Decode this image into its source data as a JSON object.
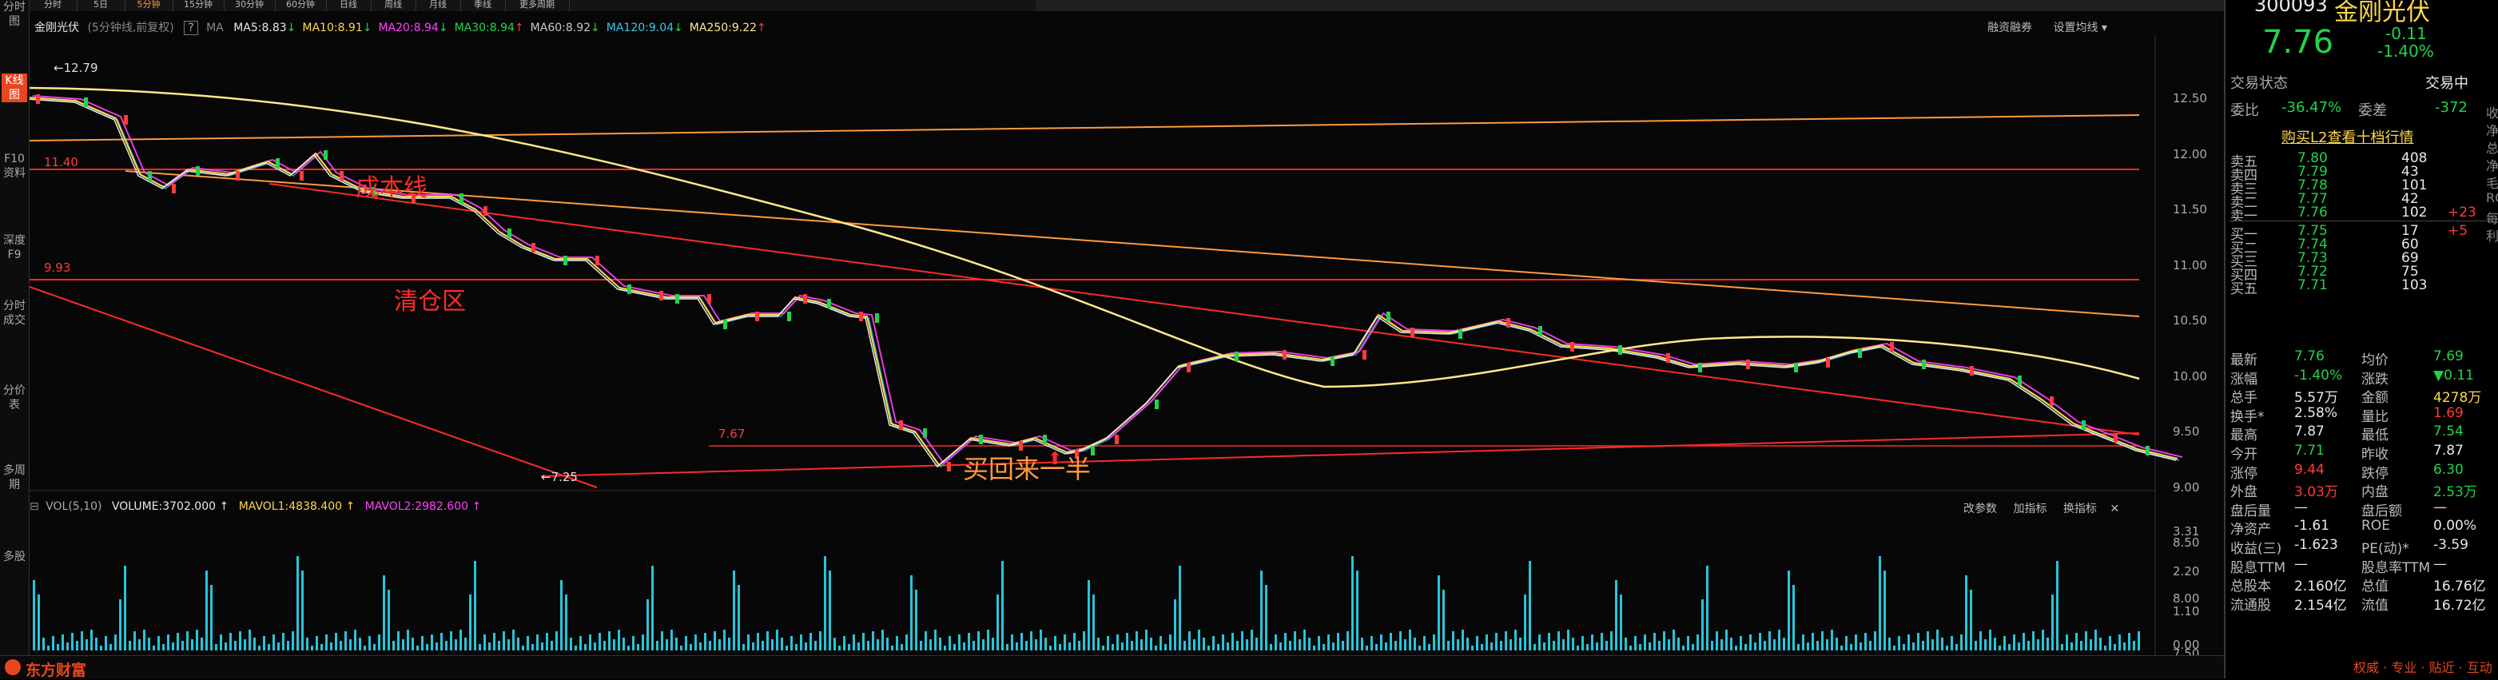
{
  "top_tabs": [
    "分时",
    "5日",
    "5分钟",
    "15分钟",
    "30分钟",
    "60分钟",
    "日线",
    "周线",
    "月线",
    "季线",
    "更多周期"
  ],
  "top_tab_active": 2,
  "left_tabs": [
    {
      "label": "分时图"
    },
    {
      "label": "K线图",
      "active": true
    },
    {
      "label": "F10资料"
    },
    {
      "label": "深度F9"
    },
    {
      "label": "分时成交"
    },
    {
      "label": "分价表"
    },
    {
      "label": "多周期"
    },
    {
      "label": "多股"
    }
  ],
  "chart_header": {
    "stock_name": "金刚光伏",
    "period_note": "(5分钟线,前复权)",
    "help": "?",
    "ma_label": "MA",
    "ma_items": [
      {
        "text": "MA5:8.83",
        "arrow": "↓",
        "color": "#e8e8e8"
      },
      {
        "text": "MA10:8.91",
        "arrow": "↓",
        "color": "#ffd84a"
      },
      {
        "text": "MA20:8.94",
        "arrow": "↓",
        "color": "#ff40ff"
      },
      {
        "text": "MA30:8.94",
        "arrow": "↑",
        "color": "#22d34b"
      },
      {
        "text": "MA60:8.92",
        "arrow": "↓",
        "color": "#c8c8c8"
      },
      {
        "text": "MA120:9.04",
        "arrow": "↓",
        "color": "#38c6e6"
      },
      {
        "text": "MA250:9.22",
        "arrow": "↑",
        "color": "#ffe88a"
      }
    ],
    "right_links": [
      "融资融券",
      "设置均线"
    ]
  },
  "price_axis": [
    "12.50",
    "12.00",
    "11.50",
    "11.00",
    "10.50",
    "10.00",
    "9.50",
    "9.00",
    "8.50",
    "8.00",
    "7.50"
  ],
  "price_marks": {
    "high": "12.79",
    "low": "7.25",
    "line_1140": "11.40",
    "line_993": "9.93",
    "line_767": "7.67"
  },
  "annotations": {
    "cost_line": "成本线",
    "clear_position": "清仓区",
    "buy_back": "买回来一半"
  },
  "volume_header": {
    "vol_label": "VOL(5,10)",
    "volume": "VOLUME:3702.000",
    "vol_arrow": "↑",
    "mavol1": "MAVOL1:4838.400",
    "mavol1_arrow": "↑",
    "mavol2": "MAVOL2:2982.600",
    "mavol2_arrow": "↑",
    "right_links": [
      "改参数",
      "加指标",
      "换指标"
    ]
  },
  "volume_axis": [
    "3.31",
    "2.20",
    "1.10",
    "0.00"
  ],
  "footer": {
    "logo": "东方财富"
  },
  "quote": {
    "code": "300093",
    "name": "金刚光伏",
    "price": "7.76",
    "change": "-0.11",
    "change_pct": "-1.40%",
    "trade_status_label": "交易状态",
    "trade_status": "交易中",
    "weibi_label": "委比",
    "weibi": "-36.47%",
    "weicha_label": "委差",
    "weicha": "-372",
    "l2_link": "购买L2查看十档行情",
    "asks": [
      {
        "label": "卖五",
        "price": "7.80",
        "vol": "408",
        "chg": ""
      },
      {
        "label": "卖四",
        "price": "7.79",
        "vol": "43",
        "chg": ""
      },
      {
        "label": "卖三",
        "price": "7.78",
        "vol": "101",
        "chg": ""
      },
      {
        "label": "卖二",
        "price": "7.77",
        "vol": "42",
        "chg": ""
      },
      {
        "label": "卖一",
        "price": "7.76",
        "vol": "102",
        "chg": "+23"
      }
    ],
    "bids": [
      {
        "label": "买一",
        "price": "7.75",
        "vol": "17",
        "chg": "+5"
      },
      {
        "label": "买二",
        "price": "7.74",
        "vol": "60",
        "chg": ""
      },
      {
        "label": "买三",
        "price": "7.73",
        "vol": "69",
        "chg": ""
      },
      {
        "label": "买四",
        "price": "7.72",
        "vol": "75",
        "chg": ""
      },
      {
        "label": "买五",
        "price": "7.71",
        "vol": "103",
        "chg": ""
      }
    ],
    "stats": [
      {
        "l1": "最新",
        "v1": "7.76",
        "c1": "green",
        "l2": "均价",
        "v2": "7.69",
        "c2": "green"
      },
      {
        "l1": "涨幅",
        "v1": "-1.40%",
        "c1": "green",
        "l2": "涨跌",
        "v2": "▼0.11",
        "c2": "green"
      },
      {
        "l1": "总手",
        "v1": "5.57万",
        "c1": "white",
        "l2": "金额",
        "v2": "4278万",
        "c2": "yellow"
      },
      {
        "l1": "换手*",
        "v1": "2.58%",
        "c1": "white",
        "l2": "量比",
        "v2": "1.69",
        "c2": "red"
      },
      {
        "l1": "最高",
        "v1": "7.87",
        "c1": "white",
        "l2": "最低",
        "v2": "7.54",
        "c2": "green"
      },
      {
        "l1": "今开",
        "v1": "7.71",
        "c1": "green",
        "l2": "昨收",
        "v2": "7.87",
        "c2": "white"
      },
      {
        "l1": "涨停",
        "v1": "9.44",
        "c1": "red",
        "l2": "跌停",
        "v2": "6.30",
        "c2": "green"
      },
      {
        "l1": "外盘",
        "v1": "3.03万",
        "c1": "red",
        "l2": "内盘",
        "v2": "2.53万",
        "c2": "green"
      },
      {
        "l1": "盘后量",
        "v1": "—",
        "c1": "white",
        "l2": "盘后额",
        "v2": "—",
        "c2": "white"
      },
      {
        "l1": "净资产",
        "v1": "-1.61",
        "c1": "white",
        "l2": "ROE",
        "v2": "0.00%",
        "c2": "white"
      },
      {
        "l1": "收益(三)",
        "v1": "-1.623",
        "c1": "white",
        "l2": "PE(动)*",
        "v2": "-3.59",
        "c2": "white"
      },
      {
        "l1": "股息TTM",
        "v1": "—",
        "c1": "white",
        "l2": "股息率TTM",
        "v2": "—",
        "c2": "white"
      },
      {
        "l1": "总股本",
        "v1": "2.160亿",
        "c1": "white",
        "l2": "总值",
        "v2": "16.76亿",
        "c2": "white"
      },
      {
        "l1": "流通股",
        "v1": "2.154亿",
        "c1": "white",
        "l2": "流值",
        "v2": "16.72亿",
        "c2": "white"
      }
    ],
    "side_labels": [
      "收",
      "净",
      "总",
      "净",
      "毛",
      "RO",
      "每",
      "利"
    ],
    "footer_text": "权威 · 专业 · 贴近 · 互动"
  },
  "colors": {
    "accent": "#e8461e",
    "up": "#ff3b3b",
    "down": "#22d34b",
    "orange": "#ff9a3c"
  }
}
